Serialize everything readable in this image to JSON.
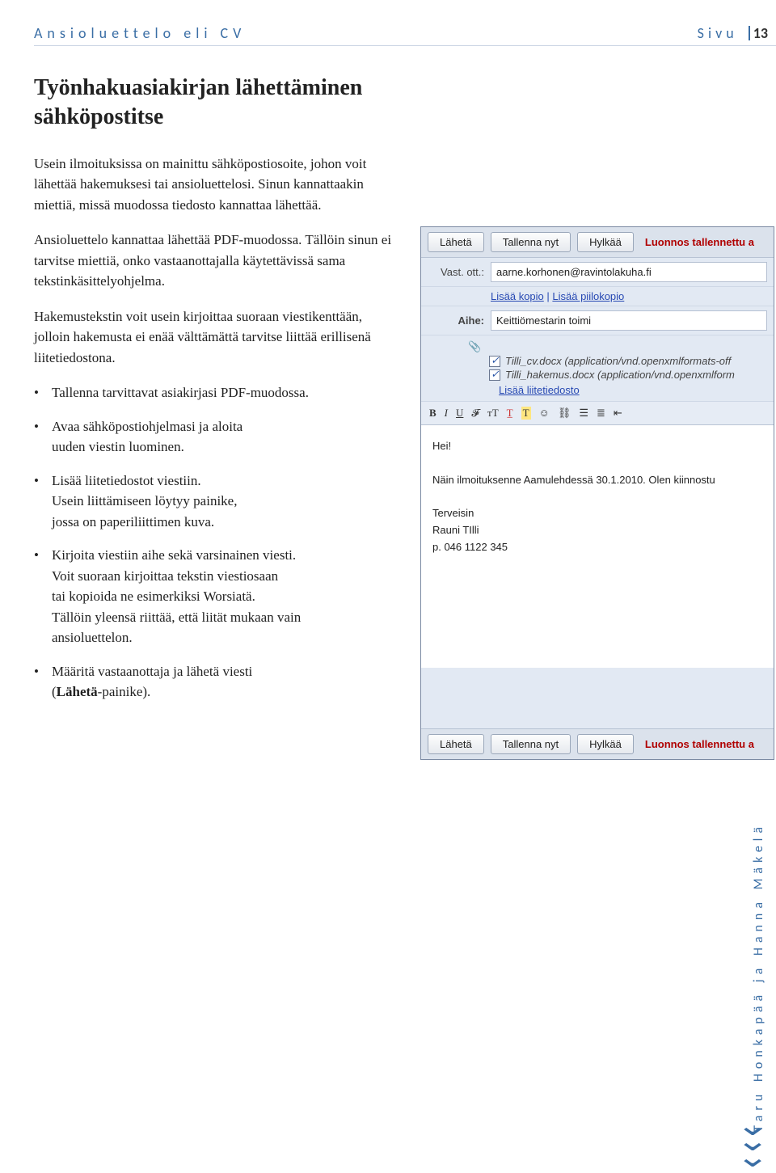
{
  "header": {
    "left": "Ansioluettelo eli CV",
    "right_label": "Sivu",
    "page_num": "13"
  },
  "title_line1": "Työnhakuasiakirjan lähettäminen",
  "title_line2": "sähköpostitse",
  "paras": {
    "p1": "Usein ilmoituksissa on mainittu sähköpostiosoite, johon voit lähettää hakemuksesi tai ansioluettelosi. Sinun kannattaakin miettiä, missä muodossa tiedosto kannattaa lähettää.",
    "p2": "Ansioluettelo kannattaa lähettää PDF-muodossa. Tällöin sinun ei tarvitse miettiä, onko vastaanottajalla käytettävissä sama tekstinkäsittelyohjelma.",
    "p3": "Hakemustekstin voit usein kirjoittaa suoraan viestikenttään, jolloin hakemusta ei enää välttämättä tarvitse liittää erillisenä liitetiedostona."
  },
  "bullets": {
    "b1": "Tallenna tarvittavat asiakirjasi PDF-muodossa.",
    "b2a": "Avaa sähköpostiohjelmasi ja aloita",
    "b2b": "uuden viestin luominen.",
    "b3a": "Lisää liitetiedostot viestiin.",
    "b3b": "Usein liittämiseen löytyy painike,",
    "b3c": " jossa on paperiliittimen kuva.",
    "b4a": "Kirjoita viestiin aihe sekä varsinainen viesti.",
    "b4b": "Voit suoraan kirjoittaa tekstin viestiosaan",
    "b4c": "tai kopioida ne esimerkiksi Worsiatä.",
    "b4d": "Tällöin yleensä riittää, että liität mukaan vain",
    "b4e": "ansioluettelon.",
    "b5a": "Määritä vastaanottaja ja lähetä viesti",
    "b5b_pre": "(",
    "b5b_strong": "Lähetä",
    "b5b_post": "-painike)."
  },
  "email": {
    "send": "Lähetä",
    "save": "Tallenna nyt",
    "discard": "Hylkää",
    "draft_saved": "Luonnos tallennettu a",
    "to_label": "Vast. ott.:",
    "to_value": "aarne.korhonen@ravintolakuha.fi",
    "add_cc": "Lisää kopio",
    "add_bcc": "Lisää piilokopio",
    "subject_label": "Aihe:",
    "subject_value": "Keittiömestarin toimi",
    "att1": "Tilli_cv.docx (application/vnd.openxmlformats-off",
    "att2": "Tilli_hakemus.docx (application/vnd.openxmlform",
    "add_attachment": "Lisää liitetiedosto",
    "body_greeting": "Hei!",
    "body_line": "Näin ilmoituksenne Aamulehdessä 30.1.2010. Olen kiinnostu",
    "sign1": "Terveisin",
    "sign2": "Rauni TIlli",
    "sign3": "p. 046 1122 345"
  },
  "author": "Taru Honkapää ja Hanna Mäkelä"
}
